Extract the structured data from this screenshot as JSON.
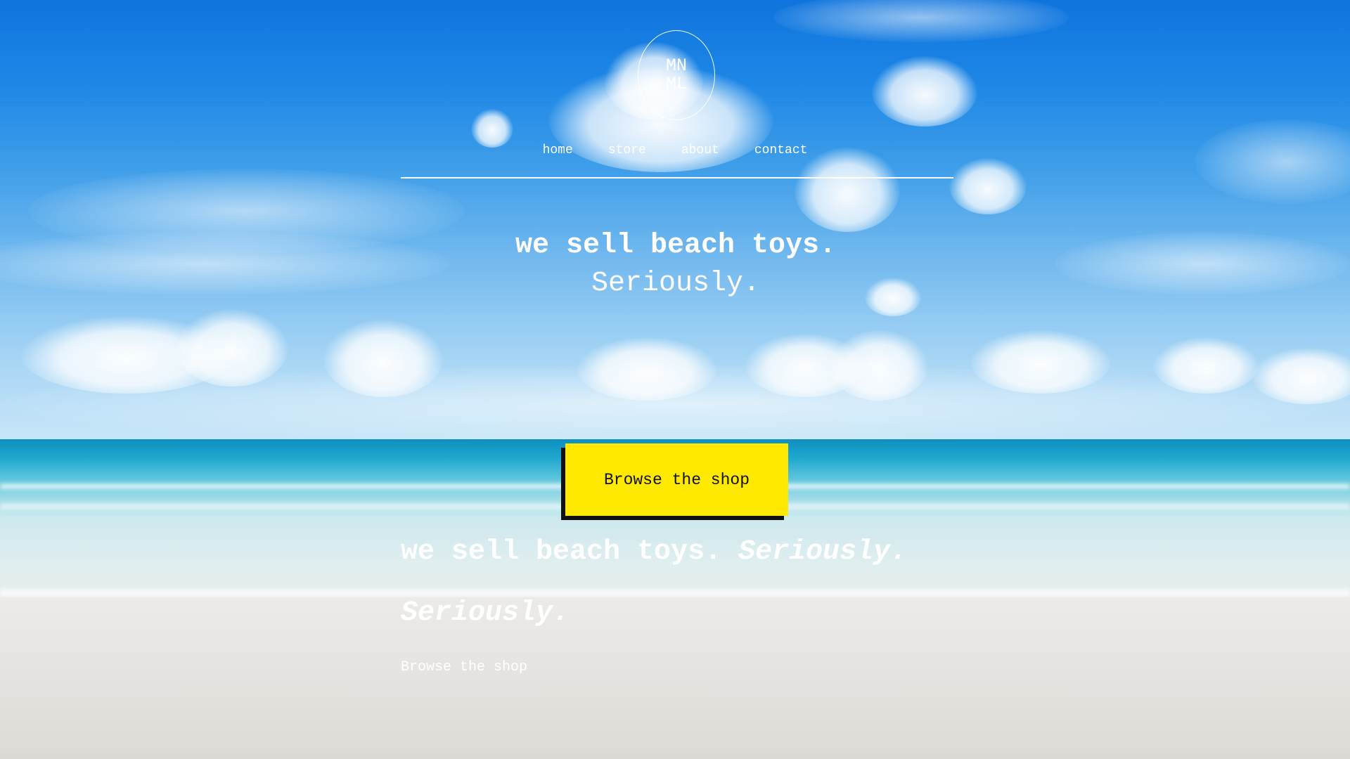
{
  "logo": {
    "line1": "MN",
    "line2": "ML"
  },
  "nav": {
    "items": [
      {
        "label": "home"
      },
      {
        "label": "store"
      },
      {
        "label": "about"
      },
      {
        "label": "contact"
      }
    ]
  },
  "hero": {
    "headline": "we sell beach toys.",
    "subheadline": "Seriously.",
    "cta_label": "Browse the shop"
  },
  "content": {
    "line_main": "we sell beach toys.",
    "line_emph": "Seriously.",
    "line2": "Seriously.",
    "link": "Browse the shop"
  },
  "colors": {
    "cta_background": "#ffe900",
    "cta_shadow": "#111111",
    "text": "#ffffff"
  }
}
